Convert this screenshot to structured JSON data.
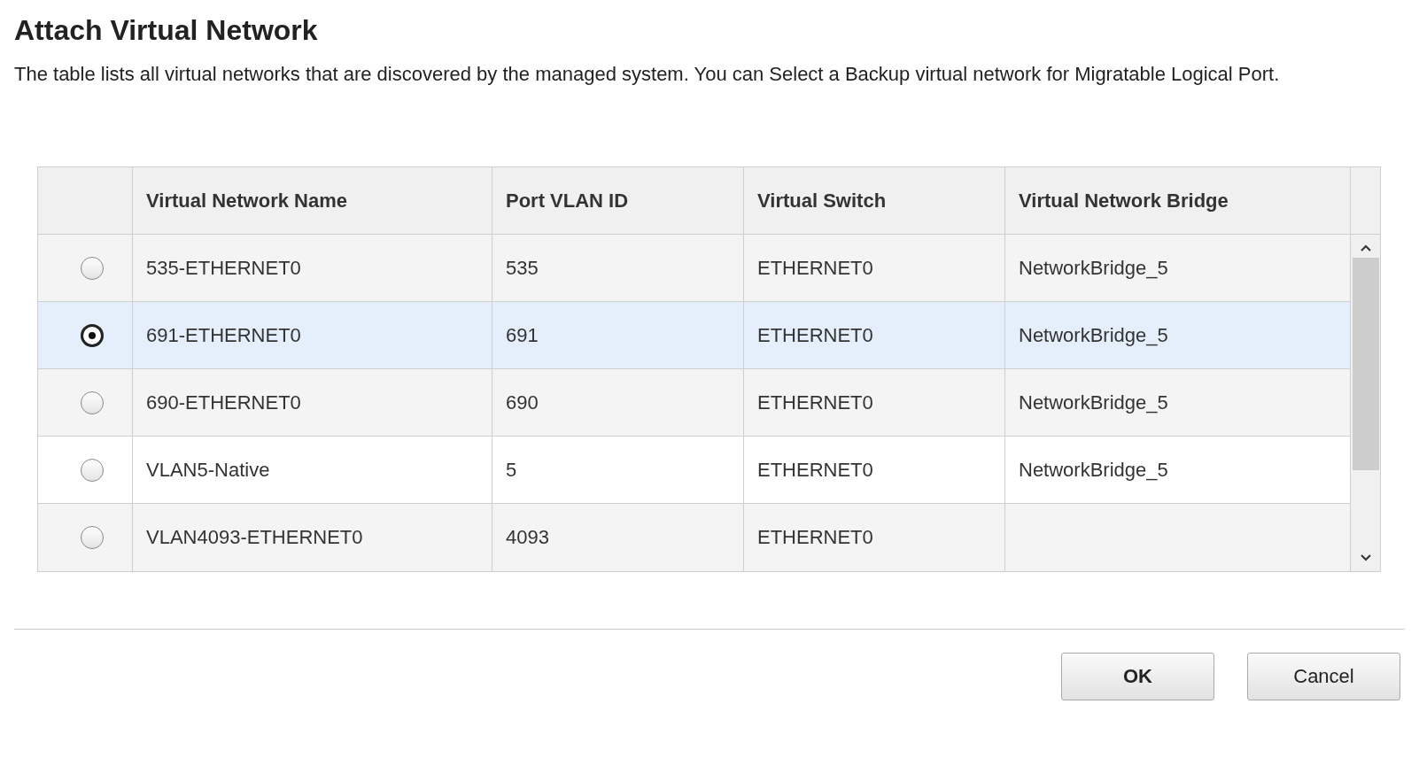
{
  "dialog": {
    "title": "Attach Virtual Network",
    "description": "The table lists all virtual networks that are discovered by the managed system. You can Select a Backup virtual network for Migratable Logical Port."
  },
  "table": {
    "columns": [
      "Virtual Network Name",
      "Port VLAN ID",
      "Virtual Switch",
      "Virtual Network Bridge"
    ],
    "rows": [
      {
        "selected": false,
        "cells": [
          "535-ETHERNET0",
          "535",
          "ETHERNET0",
          "NetworkBridge_5"
        ]
      },
      {
        "selected": true,
        "cells": [
          "691-ETHERNET0",
          "691",
          "ETHERNET0",
          "NetworkBridge_5"
        ]
      },
      {
        "selected": false,
        "cells": [
          "690-ETHERNET0",
          "690",
          "ETHERNET0",
          "NetworkBridge_5"
        ]
      },
      {
        "selected": false,
        "cells": [
          "VLAN5-Native",
          "5",
          "ETHERNET0",
          "NetworkBridge_5"
        ]
      },
      {
        "selected": false,
        "cells": [
          "VLAN4093-ETHERNET0",
          "4093",
          "ETHERNET0",
          ""
        ]
      }
    ]
  },
  "buttons": [
    "OK",
    "Cancel"
  ]
}
